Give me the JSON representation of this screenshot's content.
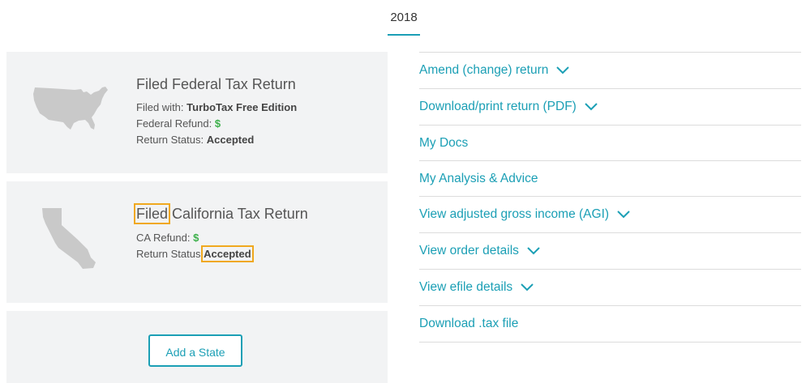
{
  "year_tab": {
    "label": "2018"
  },
  "federal": {
    "title": "Filed Federal Tax Return",
    "filed_with_label": "Filed with:",
    "filed_with_value": "TurboTax Free Edition",
    "refund_label": "Federal Refund:",
    "refund_value": "$",
    "status_label": "Return Status:",
    "status_value": "Accepted"
  },
  "state": {
    "title_status": "Filed",
    "title_rest": "California Tax Return",
    "refund_label": "CA Refund:",
    "refund_value": "$",
    "status_label": "Return Status:",
    "status_value": "Accepted"
  },
  "add_state": {
    "label": "Add a State"
  },
  "links": [
    {
      "label": "Amend (change) return",
      "chevron": true
    },
    {
      "label": "Download/print return (PDF)",
      "chevron": true
    },
    {
      "label": "My Docs",
      "chevron": false
    },
    {
      "label": "My Analysis & Advice",
      "chevron": false
    },
    {
      "label": "View adjusted gross income (AGI)",
      "chevron": true
    },
    {
      "label": "View order details",
      "chevron": true
    },
    {
      "label": "View efile details",
      "chevron": true
    },
    {
      "label": "Download .tax file",
      "chevron": false
    }
  ],
  "colors": {
    "accent": "#1b9fb5",
    "money": "#3cb04a",
    "highlight": "#f0a81e",
    "card_bg": "#f2f3f4"
  }
}
